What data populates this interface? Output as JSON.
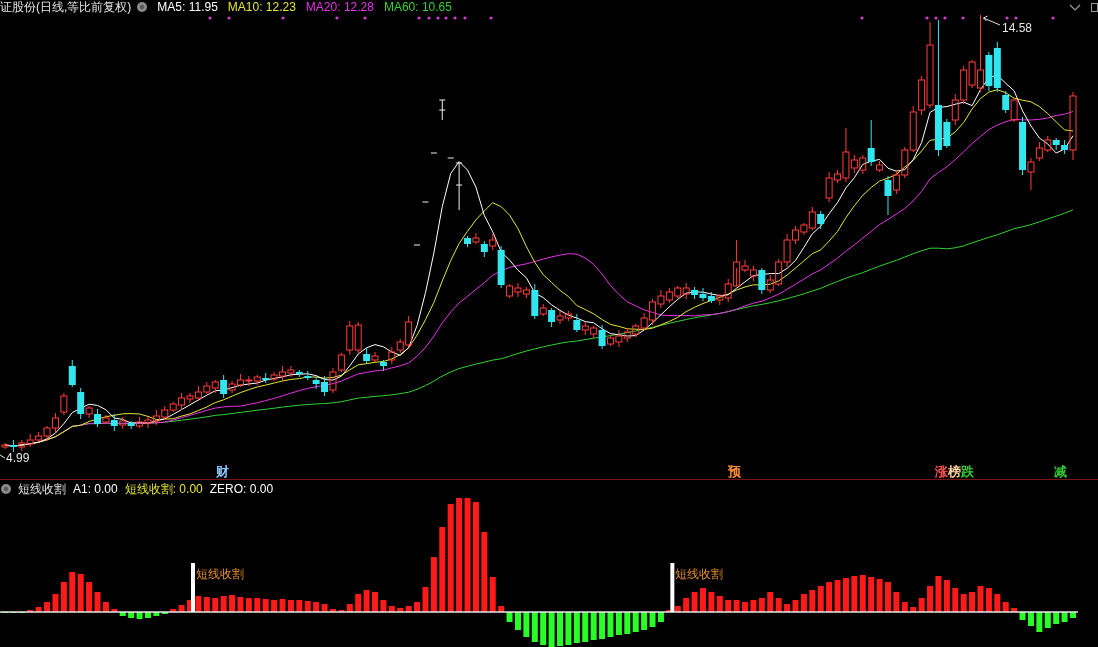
{
  "chart_header": {
    "title": "证股份(日线,等比前复权)",
    "indicators": [
      {
        "label": "MA5: 11.95",
        "color": "#ffffff"
      },
      {
        "label": "MA10: 12.23",
        "color": "#e6e632"
      },
      {
        "label": "MA20: 12.28",
        "color": "#e632e6"
      },
      {
        "label": "MA60: 10.65",
        "color": "#32d232"
      }
    ]
  },
  "price_chart": {
    "high_label": "14.58",
    "low_label": "4.99",
    "event_markers": [
      {
        "text": "财",
        "color": "#8cc8ff"
      },
      {
        "text": "预",
        "color": "#ff8c32"
      },
      {
        "text": "涨",
        "color": "#ff5050"
      },
      {
        "text": "榜",
        "color": "#ffd2a0"
      },
      {
        "text": "跌",
        "color": "#32c832"
      },
      {
        "text": "减",
        "color": "#32c832"
      }
    ]
  },
  "indicator_panel": {
    "title": "短线收割",
    "values": [
      {
        "label": "A1: 0.00",
        "color": "#ffffff"
      },
      {
        "label": "短线收割: 0.00",
        "color": "#e6e632"
      },
      {
        "label": "ZERO: 0.00",
        "color": "#ffffff"
      }
    ],
    "signals": [
      {
        "label": "短线收割"
      },
      {
        "label": "短线收割"
      }
    ]
  }
}
